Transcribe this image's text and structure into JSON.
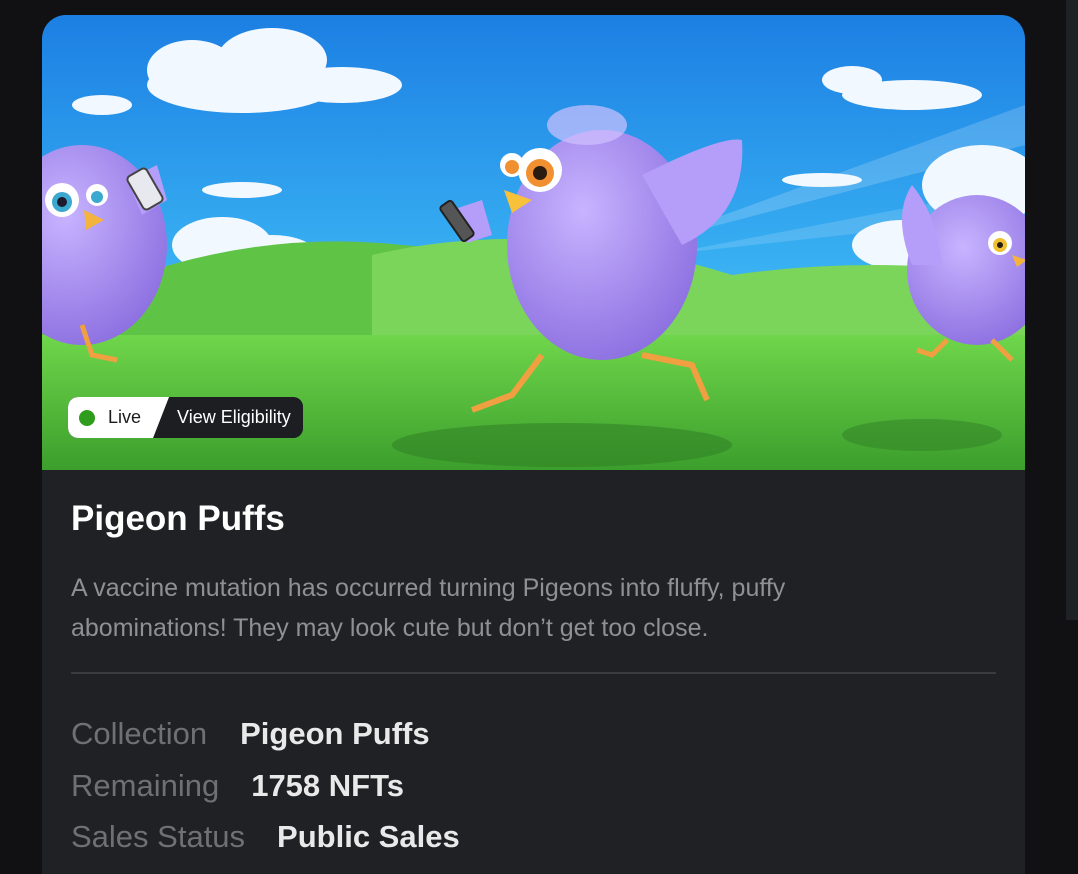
{
  "hero": {
    "image_description_icon": "pigeon-puffs-banner-illustration",
    "live_label": "Live",
    "eligibility_label": "View Eligibility"
  },
  "collection": {
    "title": "Pigeon Puffs",
    "description": "A vaccine mutation has occurred turning Pigeons into fluffy, puffy abominations! They may look cute but don’t get too close."
  },
  "details": [
    {
      "label": "Collection",
      "value": "Pigeon Puffs"
    },
    {
      "label": "Remaining",
      "value": "1758 NFTs"
    },
    {
      "label": "Sales Status",
      "value": "Public Sales"
    }
  ],
  "colors": {
    "background": "#111113",
    "card": "#202124",
    "live_dot": "#2f9c1e",
    "sky_top": "#1f86e6",
    "grass": "#55c43d",
    "pigeon": "#a98ef0"
  }
}
